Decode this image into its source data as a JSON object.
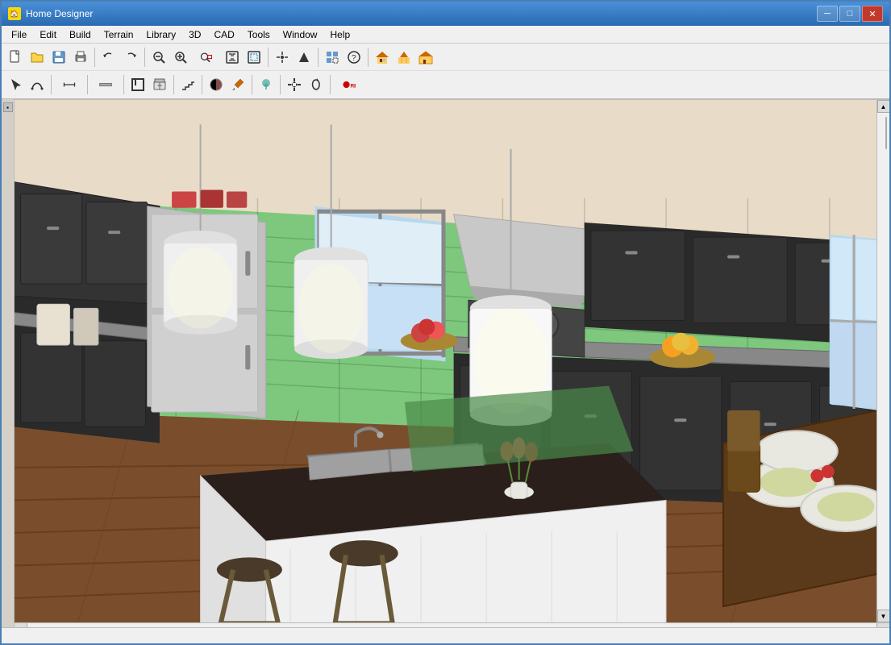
{
  "window": {
    "title": "Home Designer",
    "icon": "🏠"
  },
  "title_bar": {
    "controls": {
      "minimize": "─",
      "maximize": "□",
      "close": "✕"
    }
  },
  "menu": {
    "items": [
      "File",
      "Edit",
      "Build",
      "Terrain",
      "Library",
      "3D",
      "CAD",
      "Tools",
      "Window",
      "Help"
    ]
  },
  "toolbar1": {
    "buttons": [
      {
        "name": "new",
        "icon": "📄"
      },
      {
        "name": "open",
        "icon": "📂"
      },
      {
        "name": "save",
        "icon": "💾"
      },
      {
        "name": "print",
        "icon": "🖨"
      },
      {
        "name": "undo",
        "icon": "↶"
      },
      {
        "name": "redo",
        "icon": "↷"
      },
      {
        "name": "zoom-out",
        "icon": "🔍"
      },
      {
        "name": "zoom-in-left",
        "icon": "🔍"
      },
      {
        "name": "zoom-in-right",
        "icon": "🔍"
      },
      {
        "name": "fit",
        "icon": "⊞"
      },
      {
        "name": "window",
        "icon": "⊡"
      },
      {
        "name": "pan",
        "icon": "✛"
      },
      {
        "name": "arrow-up",
        "icon": "↑"
      },
      {
        "name": "object",
        "icon": "⬜"
      },
      {
        "name": "help",
        "icon": "?"
      },
      {
        "name": "house1",
        "icon": "🏠"
      },
      {
        "name": "house2",
        "icon": "🏠"
      },
      {
        "name": "house3",
        "icon": "🏠"
      }
    ]
  },
  "toolbar2": {
    "buttons": [
      {
        "name": "select",
        "icon": "↖"
      },
      {
        "name": "polyline",
        "icon": "⌒"
      },
      {
        "name": "measure",
        "icon": "↔"
      },
      {
        "name": "wall",
        "icon": "▬"
      },
      {
        "name": "room",
        "icon": "⬜"
      },
      {
        "name": "cabinet",
        "icon": "🗄"
      },
      {
        "name": "stairs",
        "icon": "▤"
      },
      {
        "name": "material",
        "icon": "🎨"
      },
      {
        "name": "paint",
        "icon": "🖌"
      },
      {
        "name": "terrain",
        "icon": "⛰"
      },
      {
        "name": "move",
        "icon": "✛"
      },
      {
        "name": "transform",
        "icon": "⟳"
      },
      {
        "name": "record",
        "icon": "⏺"
      }
    ]
  },
  "viewport": {
    "description": "3D kitchen rendering view"
  },
  "status_bar": {
    "text": ""
  }
}
